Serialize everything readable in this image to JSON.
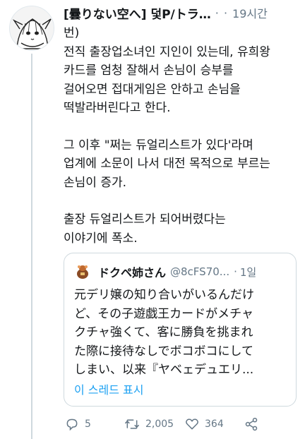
{
  "tweet": {
    "author_name": "[曇りない空へ] 덫P/トラ…",
    "dots": "· ·",
    "time": "19시간",
    "body_lines_1": [
      "번)",
      "전직 출장업소녀인 지인이 있는데, 유희왕",
      "카드를 엄청 잘해서 손님이 승부를",
      "걸어오면 접대게임은 안하고 손님을",
      "떡발라버린다고 한다."
    ],
    "body_lines_2": [
      "그 이후 \"쩌는 듀얼리스트가 있다'라며",
      "업계에 소문이 나서 대전 목적으로 부르는",
      "손님이 증가."
    ],
    "body_lines_3": [
      "출장 듀얼리스트가 되어버렸다는",
      "이야기에 폭소."
    ]
  },
  "quote": {
    "name": "ドクペ姉さん",
    "handle": "@8cFS70...",
    "time": "1일",
    "text_lines": [
      "元デリ嬢の知り合いがいるんだけ",
      "ど、その子遊戯王カードがメチャ",
      "クチャ強くて、客に勝負を挑まれ",
      "た際に接待なしでボコボコにして",
      "しまい、以来『ヤベェデュエリ..."
    ],
    "show_thread": "이 스레드 표시"
  },
  "actions": {
    "reply_count": "5",
    "retweet_count": "2,005",
    "like_count": "364"
  },
  "colors": {
    "accent": "#1da1f2",
    "muted": "#657786",
    "text": "#14171a",
    "border": "#cfd9de"
  },
  "icons": [
    "avatar-anime-character",
    "reply-icon",
    "retweet-icon",
    "like-icon",
    "share-icon"
  ]
}
